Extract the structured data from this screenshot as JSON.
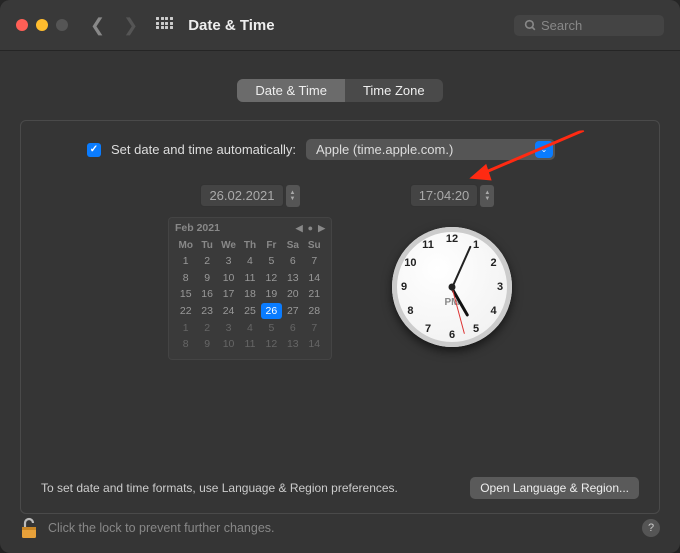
{
  "titlebar": {
    "title": "Date & Time",
    "search_placeholder": "Search"
  },
  "segments": {
    "datetime": "Date & Time",
    "timezone": "Time Zone"
  },
  "auto": {
    "label": "Set date and time automatically:",
    "server": "Apple (time.apple.com.)",
    "checked": true
  },
  "date": {
    "field": "26.02.2021",
    "month_label": "Feb 2021",
    "weekdays": [
      "Mo",
      "Tu",
      "We",
      "Th",
      "Fr",
      "Sa",
      "Su"
    ],
    "weeks": [
      [
        "1",
        "2",
        "3",
        "4",
        "5",
        "6",
        "7"
      ],
      [
        "8",
        "9",
        "10",
        "11",
        "12",
        "13",
        "14"
      ],
      [
        "15",
        "16",
        "17",
        "18",
        "19",
        "20",
        "21"
      ],
      [
        "22",
        "23",
        "24",
        "25",
        "26",
        "27",
        "28"
      ],
      [
        "1",
        "2",
        "3",
        "4",
        "5",
        "6",
        "7"
      ],
      [
        "8",
        "9",
        "10",
        "11",
        "12",
        "13",
        "14"
      ]
    ],
    "today": "26"
  },
  "time": {
    "field": "17:04:20",
    "ampm": "PM",
    "clock_numbers": [
      "12",
      "1",
      "2",
      "3",
      "4",
      "5",
      "6",
      "7",
      "8",
      "9",
      "10",
      "11"
    ]
  },
  "footer": {
    "hint": "To set date and time formats, use Language & Region preferences.",
    "button": "Open Language & Region..."
  },
  "lock": {
    "text": "Click the lock to prevent further changes."
  },
  "colors": {
    "accent": "#0a7cff",
    "arrow": "#ff2a12"
  }
}
